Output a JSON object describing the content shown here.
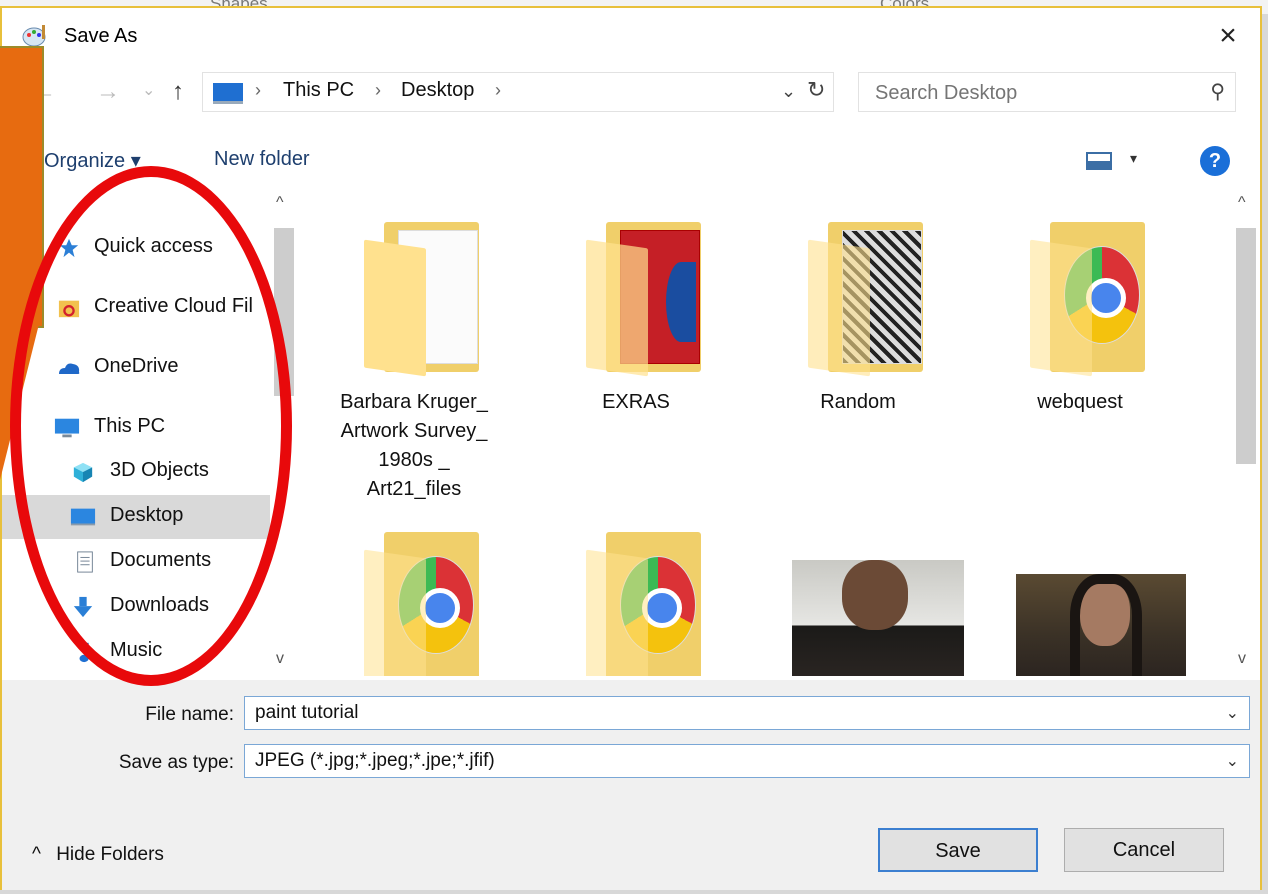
{
  "background_window": {
    "left_tab": "Shapes",
    "right_tab": "Colors"
  },
  "dialog": {
    "title": "Save As",
    "app_icon": "paint-palette-icon",
    "close_icon": "×"
  },
  "navigation": {
    "back_icon": "←",
    "forward_icon": "→",
    "recent_icon": "⌄",
    "up_icon": "↑",
    "breadcrumbs": [
      "This PC",
      "Desktop"
    ],
    "separator": "›",
    "dropdown_icon": "⌄",
    "refresh_icon": "↻",
    "search_placeholder": "Search Desktop",
    "search_icon": "⚲"
  },
  "toolbar": {
    "organize_label": "Organize ▾",
    "new_folder_label": "New folder",
    "view_dropdown": "▾",
    "help_label": "?"
  },
  "sidebar": {
    "items": [
      {
        "label": "Quick access",
        "icon": "star-icon"
      },
      {
        "label": "Creative Cloud Fil",
        "icon": "creative-cloud-icon"
      },
      {
        "label": "OneDrive",
        "icon": "onedrive-icon"
      },
      {
        "label": "This PC",
        "icon": "computer-icon"
      },
      {
        "label": "3D Objects",
        "icon": "cube-icon"
      },
      {
        "label": "Desktop",
        "icon": "desktop-icon",
        "selected": true
      },
      {
        "label": "Documents",
        "icon": "document-icon"
      },
      {
        "label": "Downloads",
        "icon": "download-arrow-icon"
      },
      {
        "label": "Music",
        "icon": "music-note-icon"
      }
    ],
    "scroll_up": "^",
    "scroll_down": "v"
  },
  "files": {
    "items": [
      {
        "name": "Barbara Kruger_ Artwork Survey_ 1980s _ Art21_files",
        "lines": [
          "Barbara Kruger_",
          "Artwork Survey_",
          "1980s _",
          "Art21_files"
        ],
        "kind": "folder-docs"
      },
      {
        "name": "EXRAS",
        "lines": [
          "EXRAS"
        ],
        "kind": "folder-adobe"
      },
      {
        "name": "Random",
        "lines": [
          "Random"
        ],
        "kind": "folder-photos"
      },
      {
        "name": "webquest",
        "lines": [
          "webquest"
        ],
        "kind": "folder-chrome"
      },
      {
        "name": "",
        "lines": [],
        "kind": "folder-chrome"
      },
      {
        "name": "",
        "lines": [],
        "kind": "folder-chrome"
      },
      {
        "name": "",
        "lines": [],
        "kind": "photo-snow"
      },
      {
        "name": "",
        "lines": [],
        "kind": "photo-portrait"
      }
    ],
    "scroll_up": "^",
    "scroll_down": "v"
  },
  "form": {
    "file_name_label": "File name:",
    "file_name_value": "paint tutorial",
    "save_type_label": "Save as type:",
    "save_type_value": "JPEG (*.jpg;*.jpeg;*.jpe;*.jfif)",
    "caret": "⌄"
  },
  "footer": {
    "hide_folders_label": "Hide Folders",
    "hide_folders_icon": "^",
    "save_label": "Save",
    "cancel_label": "Cancel"
  },
  "annotation_colors": {
    "callout": "#e76b10",
    "ellipse": "#e8090b"
  }
}
